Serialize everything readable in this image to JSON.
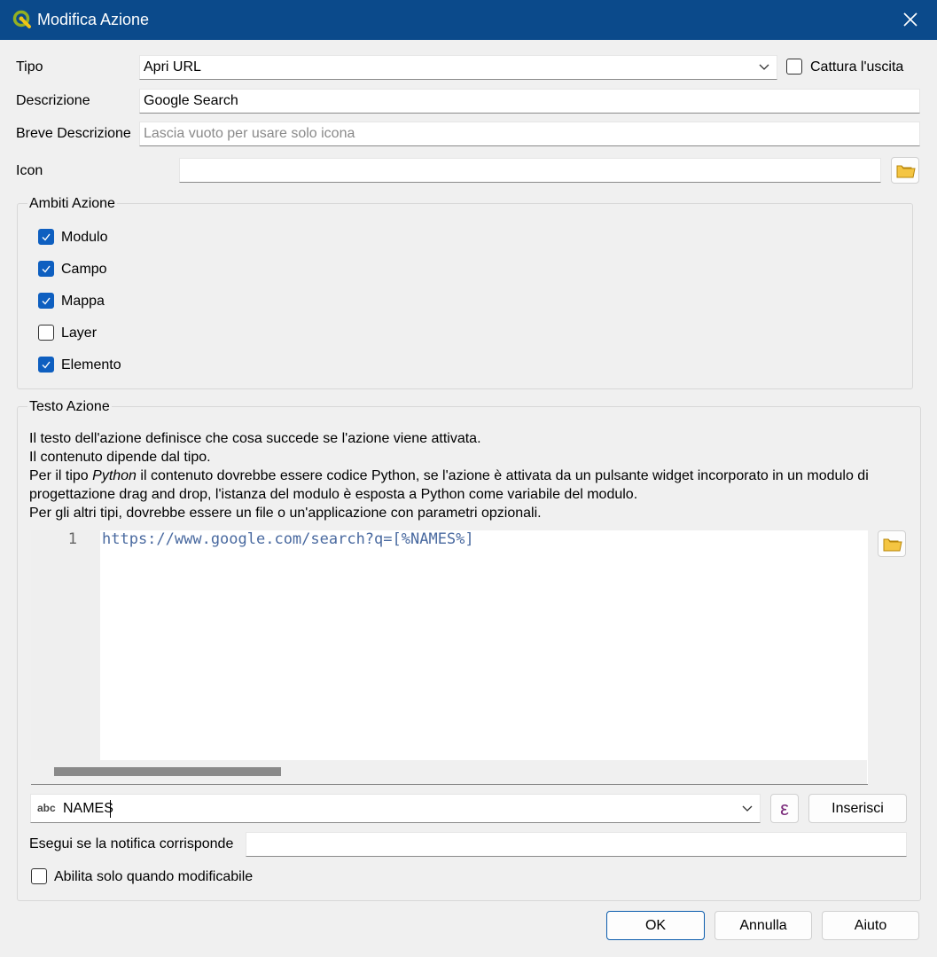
{
  "window": {
    "title": "Modifica Azione"
  },
  "form": {
    "tipo_label": "Tipo",
    "tipo_value": "Apri URL",
    "capture_label": "Cattura l'uscita",
    "descrizione_label": "Descrizione",
    "descrizione_value": "Google Search",
    "breve_label": "Breve Descrizione",
    "breve_placeholder": "Lascia vuoto per usare solo icona",
    "icon_label": "Icon",
    "icon_value": ""
  },
  "scopes": {
    "title": "Ambiti Azione",
    "items": [
      {
        "label": "Modulo",
        "checked": true
      },
      {
        "label": "Campo",
        "checked": true
      },
      {
        "label": "Mappa",
        "checked": true
      },
      {
        "label": "Layer",
        "checked": false
      },
      {
        "label": "Elemento",
        "checked": true
      }
    ]
  },
  "action_text": {
    "title": "Testo Azione",
    "desc_line1": "Il testo dell'azione definisce che cosa succede se l'azione viene attivata.",
    "desc_line2": "Il contenuto dipende dal tipo.",
    "desc_line3_a": "Per il tipo ",
    "desc_line3_em": "Python",
    "desc_line3_b": " il contenuto dovrebbe essere codice Python, se l'azione è attivata da un pulsante widget incorporato in un modulo di",
    "desc_line4": "progettazione drag and drop, l'istanza del modulo è esposta a Python come variabile del modulo.",
    "desc_line5": "Per gli altri tipi, dovrebbe essere un file o un'applicazione con parametri opzionali.",
    "line_number": "1",
    "code": "https://www.google.com/search?q=[%NAMES%]",
    "field_type_badge": "abc",
    "field_value": "NAMES",
    "insert_label": "Inserisci",
    "expression_symbol": "ε",
    "notify_label": "Esegui se la notifica corrisponde",
    "notify_value": "",
    "editable_label": "Abilita solo quando modificabile"
  },
  "buttons": {
    "ok": "OK",
    "cancel": "Annulla",
    "help": "Aiuto"
  },
  "colors": {
    "titlebar": "#0b4a8b",
    "checkbox_checked": "#0e5fc0"
  }
}
